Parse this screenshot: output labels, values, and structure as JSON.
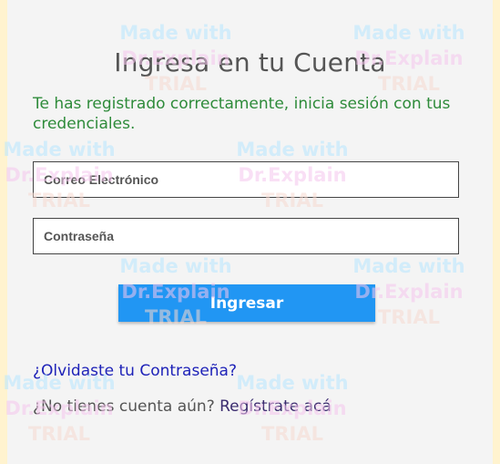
{
  "page": {
    "title": "Ingresa en tu Cuenta",
    "success_message": "Te has registrado correctamente, inicia sesión con tus credenciales."
  },
  "form": {
    "email_placeholder": "Correo Electrónico",
    "email_value": "",
    "password_placeholder": "Contraseña",
    "password_value": "",
    "submit_label": "Ingresar"
  },
  "links": {
    "forgot_password": "¿Olvidaste tu Contraseña?",
    "no_account_text": "¿No tienes cuenta aún?",
    "register_link": "Regístrate acá"
  },
  "watermark": {
    "line1": "Made with",
    "line2": "Dr.Explain",
    "line3": "TRIAL"
  },
  "colors": {
    "background": "#fff3cf",
    "card": "#f4f4f4",
    "success": "#2e8b3a",
    "button": "#2196f3",
    "link": "#1e22b8"
  }
}
